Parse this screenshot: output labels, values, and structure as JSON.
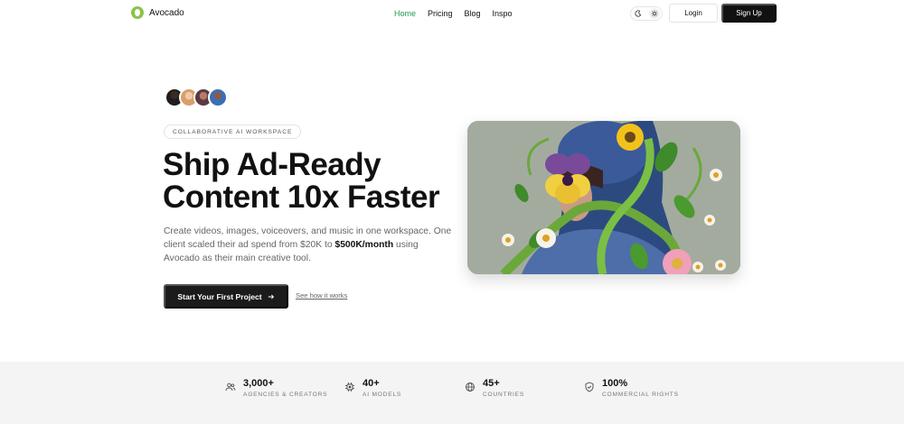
{
  "brand": {
    "name": "Avocado",
    "accent": "#1f9d55",
    "logo_color": "#8bc34a"
  },
  "nav": {
    "items": [
      {
        "label": "Home",
        "active": true
      },
      {
        "label": "Pricing",
        "active": false
      },
      {
        "label": "Blog",
        "active": false
      },
      {
        "label": "Inspo",
        "active": false
      }
    ],
    "theme_icons": [
      "moon-icon",
      "sun-icon"
    ],
    "login_label": "Login",
    "signup_label": "Sign Up"
  },
  "hero": {
    "badge": "COLLABORATIVE AI WORKSPACE",
    "headline_line1": "Ship Ad-Ready",
    "headline_line2": "Content 10x Faster",
    "sub_part1": "Create videos, images, voiceovers, and music in one workspace. One client scaled their ad spend from $20K to ",
    "sub_bold": "$500K/month",
    "sub_part2": " using Avocado as their main creative tool.",
    "cta_label": "Start Your First Project",
    "cta_icon": "arrow-right-icon",
    "secondary_link": "See how it works"
  },
  "stats": [
    {
      "value": "3,000+",
      "label": "AGENCIES & CREATORS",
      "icon": "users-icon"
    },
    {
      "value": "40+",
      "label": "AI MODELS",
      "icon": "chip-icon"
    },
    {
      "value": "45+",
      "label": "COUNTRIES",
      "icon": "globe-icon"
    },
    {
      "value": "100%",
      "label": "COMMERCIAL RIGHTS",
      "icon": "shield-icon"
    }
  ]
}
